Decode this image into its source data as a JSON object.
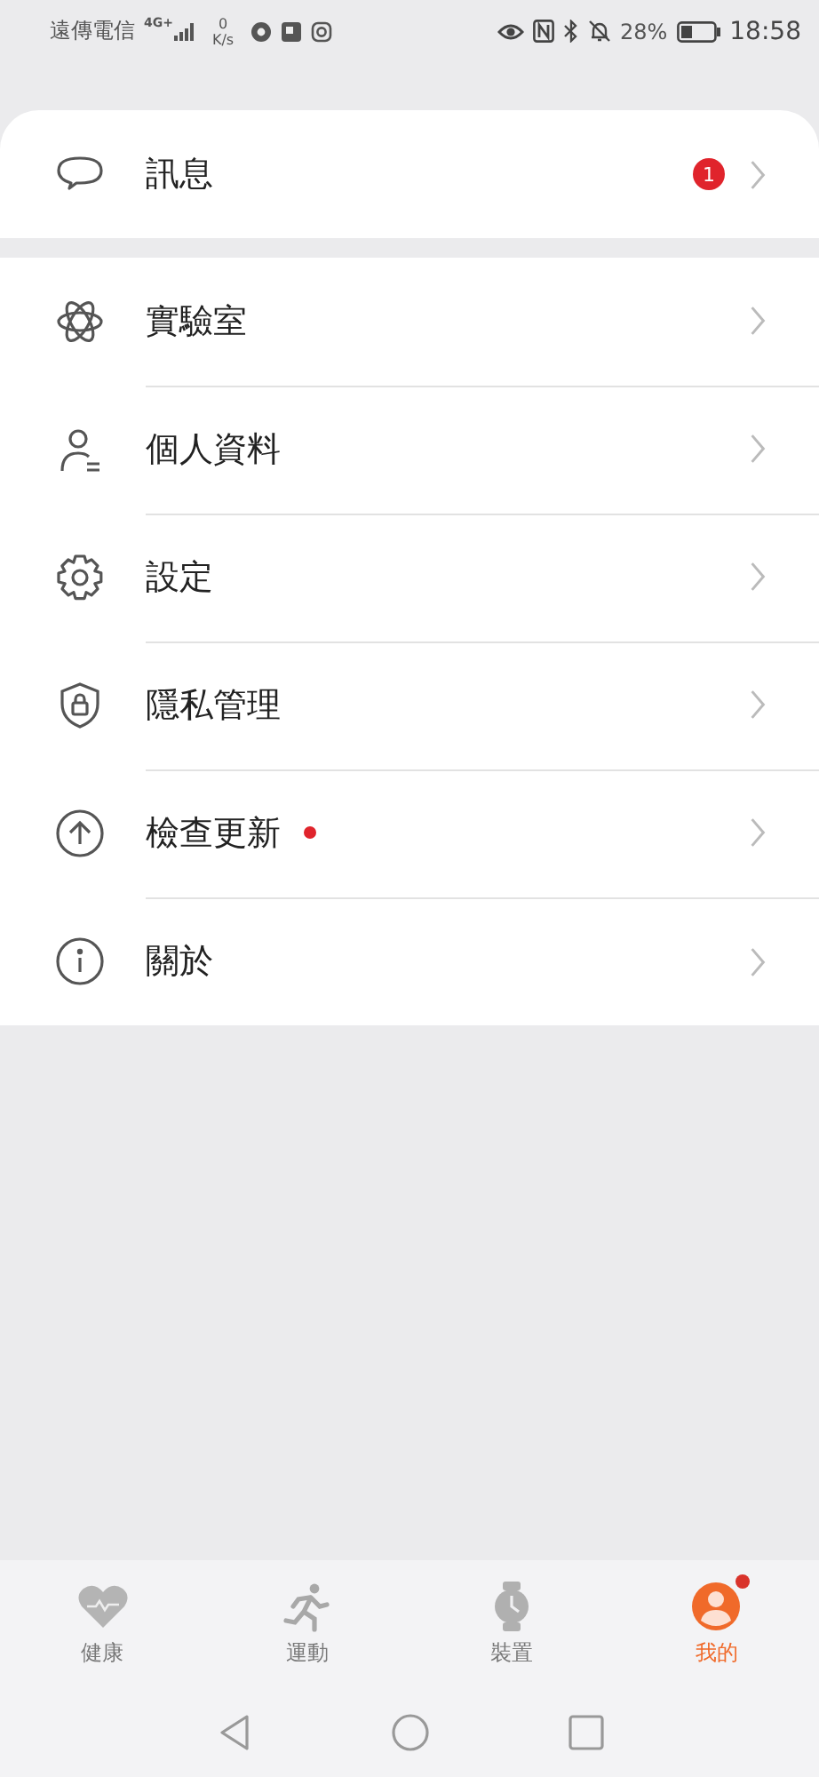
{
  "status_bar": {
    "carrier": "遠傳電信",
    "network": "4G+",
    "speed_value": "0",
    "speed_unit": "K/s",
    "battery": "28%",
    "time": "18:58"
  },
  "messages": {
    "label": "訊息",
    "badge": "1"
  },
  "menu": [
    {
      "kind": "atom",
      "label": "實驗室",
      "dot": false
    },
    {
      "kind": "person",
      "label": "個人資料",
      "dot": false
    },
    {
      "kind": "gear",
      "label": "設定",
      "dot": false
    },
    {
      "kind": "shield",
      "label": "隱私管理",
      "dot": false
    },
    {
      "kind": "update",
      "label": "檢查更新",
      "dot": true
    },
    {
      "kind": "info",
      "label": "關於",
      "dot": false
    }
  ],
  "tabs": [
    {
      "kind": "heart",
      "label": "健康",
      "selected": false,
      "dot": false
    },
    {
      "kind": "runner",
      "label": "運動",
      "selected": false,
      "dot": false
    },
    {
      "kind": "watch",
      "label": "裝置",
      "selected": false,
      "dot": false
    },
    {
      "kind": "profile",
      "label": "我的",
      "selected": true,
      "dot": true
    }
  ]
}
